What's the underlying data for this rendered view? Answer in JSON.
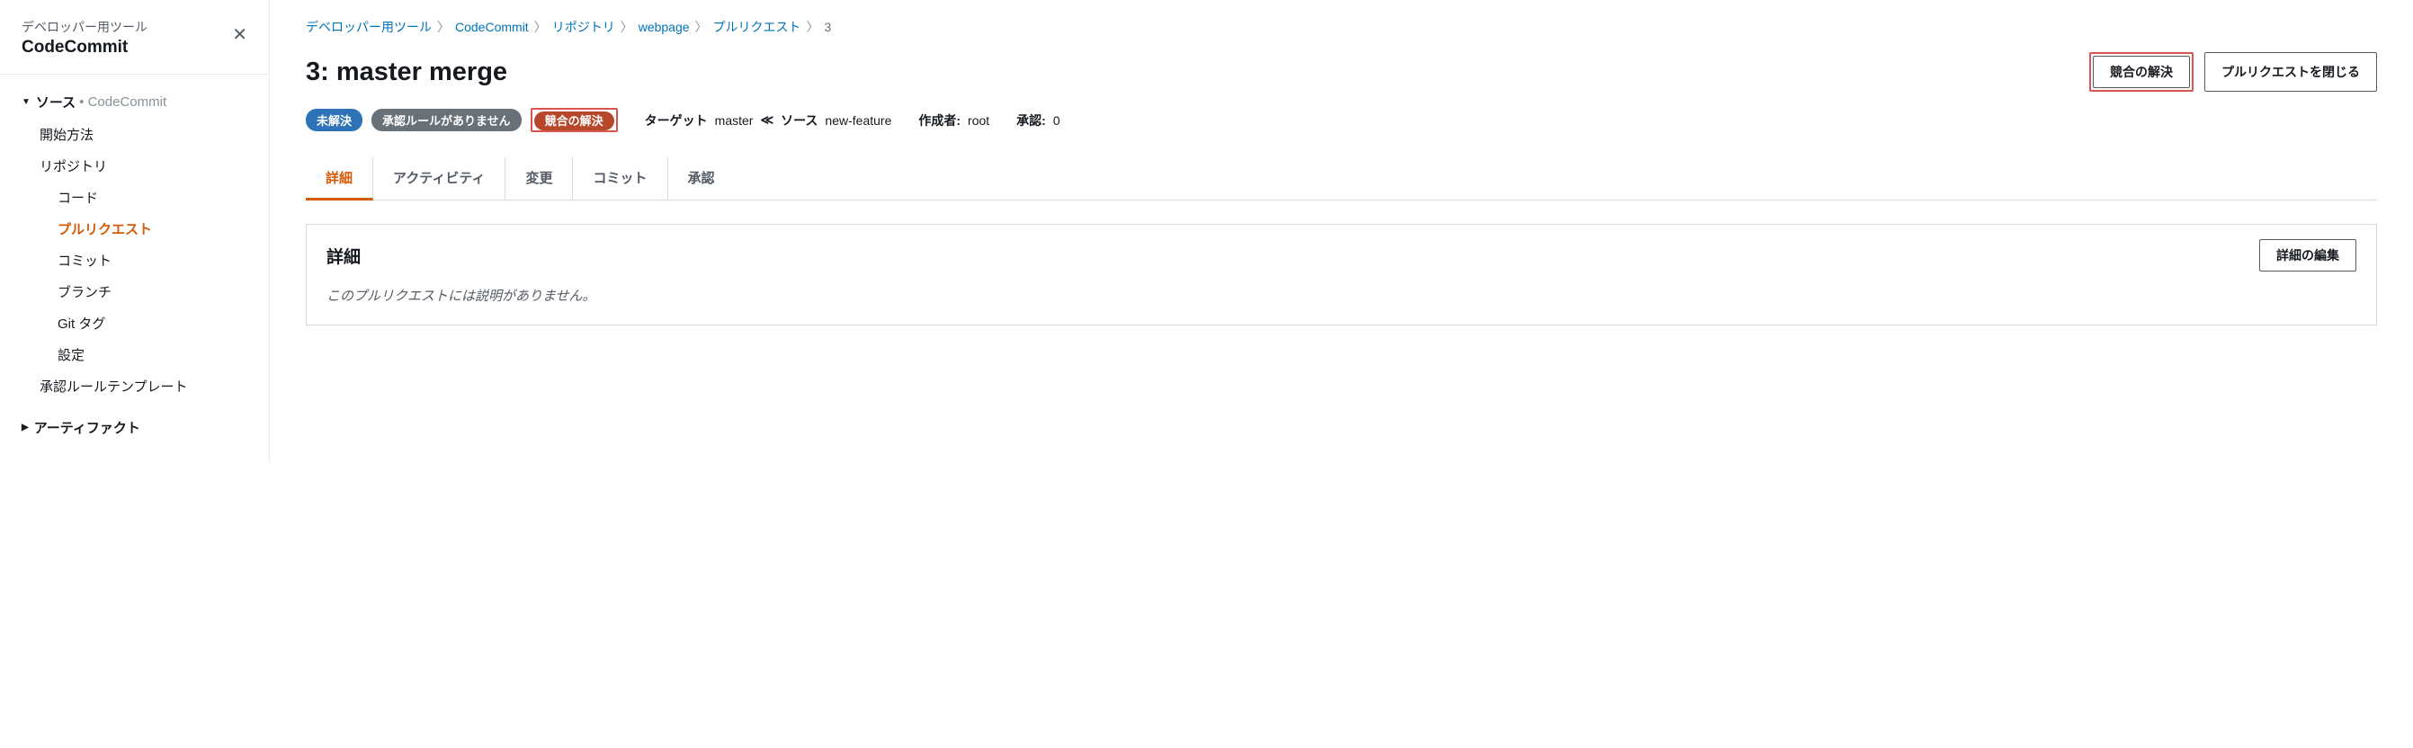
{
  "sidebar": {
    "subtitle": "デベロッパー用ツール",
    "title": "CodeCommit",
    "sections": [
      {
        "label": "ソース",
        "hint": "• CodeCommit",
        "expanded": true,
        "items": [
          {
            "label": "開始方法",
            "indent": 1
          },
          {
            "label": "リポジトリ",
            "indent": 1
          },
          {
            "label": "コード",
            "indent": 2
          },
          {
            "label": "プルリクエスト",
            "indent": 2,
            "active": true
          },
          {
            "label": "コミット",
            "indent": 2
          },
          {
            "label": "ブランチ",
            "indent": 2
          },
          {
            "label": "Git タグ",
            "indent": 2
          },
          {
            "label": "設定",
            "indent": 2
          },
          {
            "label": "承認ルールテンプレート",
            "indent": 1
          }
        ]
      },
      {
        "label": "アーティファクト",
        "hint": "",
        "expanded": false,
        "items": []
      }
    ]
  },
  "breadcrumb": [
    "デベロッパー用ツール",
    "CodeCommit",
    "リポジトリ",
    "webpage",
    "プルリクエスト",
    "3"
  ],
  "page_title": "3: master merge",
  "buttons": {
    "resolve_conflict": "競合の解決",
    "close_pr": "プルリクエストを閉じる",
    "edit_detail": "詳細の編集"
  },
  "badges": {
    "status": "未解決",
    "approval_rules": "承認ルールがありません",
    "conflict": "競合の解決"
  },
  "meta": {
    "target_label": "ターゲット",
    "target_value": "master",
    "source_label": "ソース",
    "source_value": "new-feature",
    "author_label": "作成者:",
    "author_value": "root",
    "approval_label": "承認:",
    "approval_value": "0"
  },
  "tabs": [
    "詳細",
    "アクティビティ",
    "変更",
    "コミット",
    "承認"
  ],
  "active_tab": 0,
  "panel": {
    "title": "詳細",
    "empty_text": "このプルリクエストには説明がありません。"
  }
}
